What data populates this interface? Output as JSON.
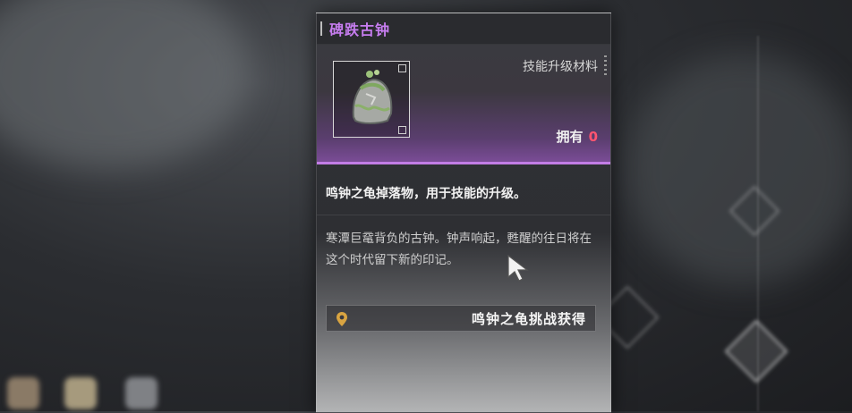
{
  "item": {
    "name": "碑跌古钟",
    "category": "技能升级材料",
    "owned_label": "拥有",
    "owned_count": "0",
    "icon": "ancient-bell-icon"
  },
  "summary": "鸣钟之龟掉落物，用于技能的升级。",
  "description": "寒潭巨鼋背负的古钟。钟声响起，甦醒的往日将在这个时代留下新的印记。",
  "source": {
    "icon": "location-pin-icon",
    "label": "鸣钟之龟挑战获得"
  },
  "colors": {
    "title": "#c77df0",
    "accent": "#c37de6",
    "owned_count": "#ff5470",
    "pin": "#d9a441"
  }
}
